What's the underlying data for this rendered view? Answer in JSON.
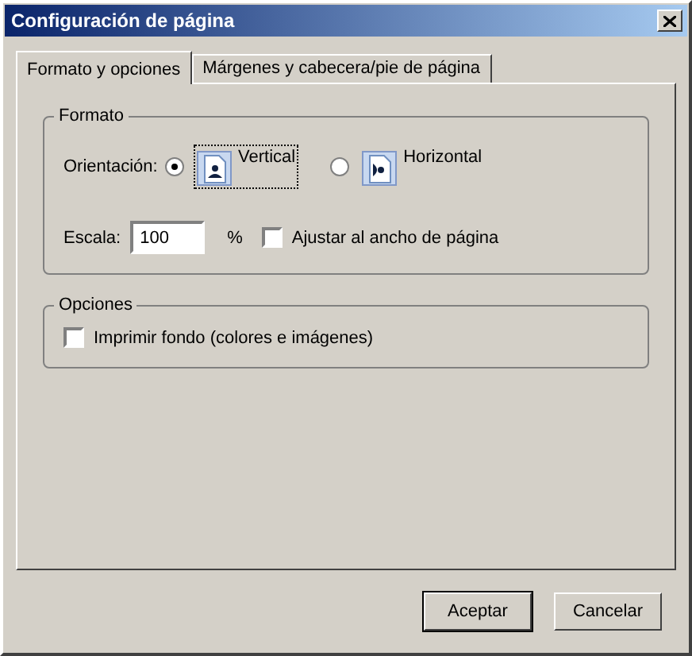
{
  "window": {
    "title": "Configuración de página"
  },
  "tabs": [
    {
      "label": "Formato y opciones",
      "selected": true
    },
    {
      "label": "Márgenes y cabecera/pie de página",
      "selected": false
    }
  ],
  "format_group": {
    "title": "Formato",
    "orientation_label": "Orientación:",
    "orientations": [
      {
        "kind": "portrait",
        "label": "Vertical",
        "selected": true,
        "focused": true
      },
      {
        "kind": "landscape",
        "label": "Horizontal",
        "selected": false,
        "focused": false
      }
    ],
    "scale_label": "Escala:",
    "scale_value": "100",
    "scale_unit": "%",
    "fit_width": {
      "label": "Ajustar al ancho de página",
      "checked": false
    }
  },
  "options_group": {
    "title": "Opciones",
    "print_background": {
      "label": "Imprimir fondo (colores e imágenes)",
      "checked": false
    }
  },
  "buttons": [
    {
      "label": "Aceptar",
      "default": true
    },
    {
      "label": "Cancelar",
      "default": false
    }
  ]
}
